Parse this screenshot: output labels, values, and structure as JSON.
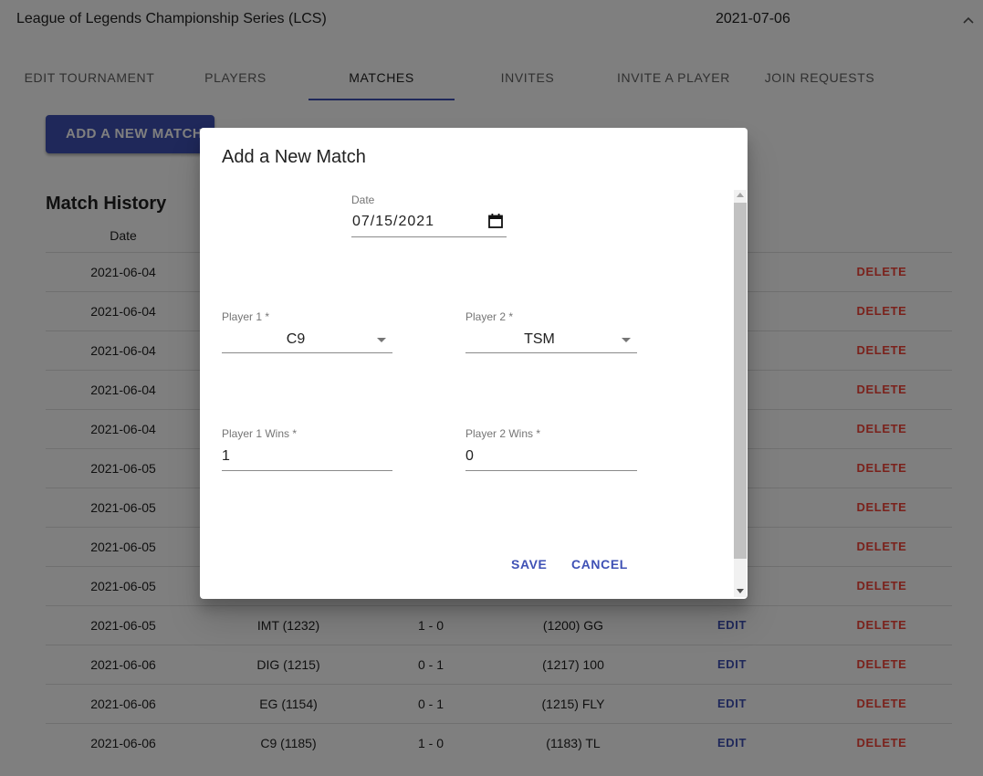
{
  "header": {
    "title": "League of Legends Championship Series (LCS)",
    "date": "2021-07-06",
    "chevron_icon": "chevron-up-icon"
  },
  "tabs": [
    {
      "label": "EDIT TOURNAMENT"
    },
    {
      "label": "PLAYERS"
    },
    {
      "label": "MATCHES",
      "active": true
    },
    {
      "label": "INVITES"
    },
    {
      "label": "INVITE A PLAYER"
    },
    {
      "label": "JOIN REQUESTS"
    }
  ],
  "add_match_button": "ADD A NEW MATCH",
  "history": {
    "title": "Match History",
    "columns": {
      "date": "Date"
    },
    "rows": [
      {
        "date": "2021-06-04",
        "delete": "DELETE"
      },
      {
        "date": "2021-06-04",
        "delete": "DELETE"
      },
      {
        "date": "2021-06-04",
        "delete": "DELETE"
      },
      {
        "date": "2021-06-04",
        "delete": "DELETE"
      },
      {
        "date": "2021-06-04",
        "delete": "DELETE"
      },
      {
        "date": "2021-06-05",
        "delete": "DELETE"
      },
      {
        "date": "2021-06-05",
        "delete": "DELETE"
      },
      {
        "date": "2021-06-05",
        "delete": "DELETE"
      },
      {
        "date": "2021-06-05",
        "delete": "DELETE"
      },
      {
        "date": "2021-06-05",
        "player1": "IMT (1232)",
        "score": "1 - 0",
        "player2": "(1200) GG",
        "edit": "EDIT",
        "delete": "DELETE"
      },
      {
        "date": "2021-06-06",
        "player1": "DIG (1215)",
        "score": "0 - 1",
        "player2": "(1217) 100",
        "edit": "EDIT",
        "delete": "DELETE"
      },
      {
        "date": "2021-06-06",
        "player1": "EG (1154)",
        "score": "0 - 1",
        "player2": "(1215) FLY",
        "edit": "EDIT",
        "delete": "DELETE"
      },
      {
        "date": "2021-06-06",
        "player1": "C9 (1185)",
        "score": "1 - 0",
        "player2": "(1183) TL",
        "edit": "EDIT",
        "delete": "DELETE"
      }
    ]
  },
  "dialog": {
    "title": "Add a New Match",
    "date": {
      "label": "Date",
      "value": "07/15/2021",
      "icon": "calendar-icon"
    },
    "player1": {
      "label": "Player 1 *",
      "value": "C9"
    },
    "player2": {
      "label": "Player 2 *",
      "value": "TSM"
    },
    "player1_wins": {
      "label": "Player 1 Wins *",
      "value": "1"
    },
    "player2_wins": {
      "label": "Player 2 Wins *",
      "value": "0"
    },
    "save_label": "SAVE",
    "cancel_label": "CANCEL"
  },
  "colors": {
    "primary": "#3f51b5",
    "danger": "#f44336",
    "backdrop": "rgba(0,0,0,0.5)"
  }
}
